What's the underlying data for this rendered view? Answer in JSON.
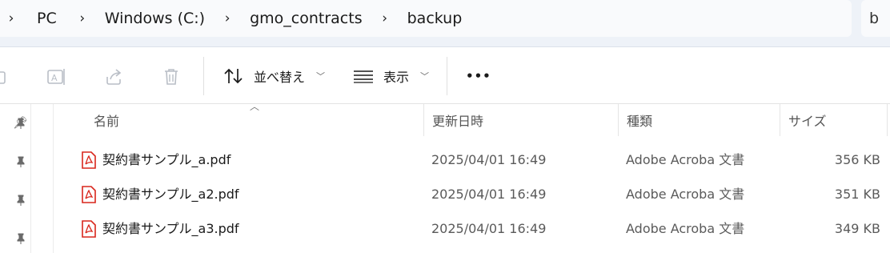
{
  "address": {
    "breadcrumbs": [
      "PC",
      "Windows (C:)",
      "gmo_contracts",
      "backup"
    ],
    "search_text": "b"
  },
  "toolbar": {
    "sort_label": "並べ替え",
    "view_label": "表示",
    "more_label": "•••"
  },
  "columns": {
    "name": "名前",
    "date": "更新日時",
    "type": "種類",
    "size": "サイズ"
  },
  "files": [
    {
      "name": "契約書サンプル_a.pdf",
      "date": "2025/04/01 16:49",
      "type": "Adobe Acroba 文書",
      "size": "356 KB"
    },
    {
      "name": "契約書サンプル_a2.pdf",
      "date": "2025/04/01 16:49",
      "type": "Adobe Acroba 文書",
      "size": "351 KB"
    },
    {
      "name": "契約書サンプル_a3.pdf",
      "date": "2025/04/01 16:49",
      "type": "Adobe Acroba 文書",
      "size": "349 KB"
    }
  ],
  "colors": {
    "pdf_red": "#d9261c",
    "accent": "#0067c0"
  }
}
